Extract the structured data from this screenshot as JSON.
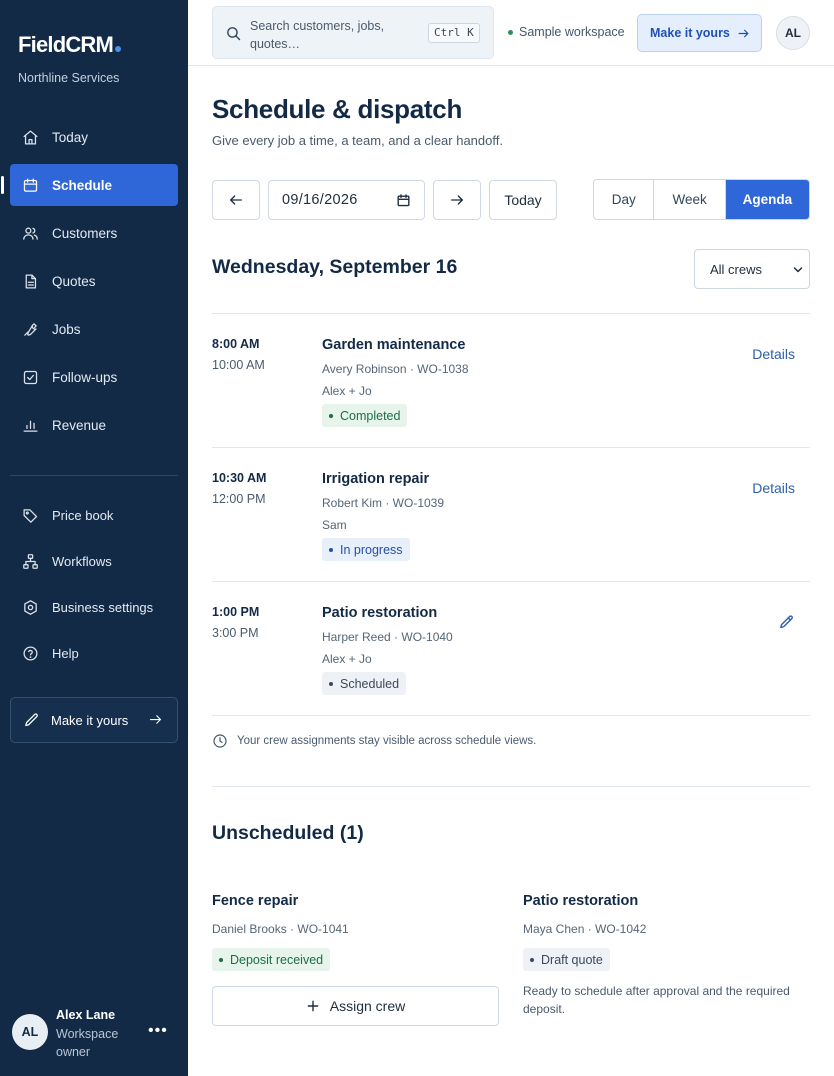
{
  "app": {
    "brand": "FieldCRM",
    "org": "Northline Services",
    "accent_color": "#2f66d8",
    "sidebar_color": "#132a46"
  },
  "sidebar": {
    "items": [
      {
        "label": "Today",
        "icon": "home-icon"
      },
      {
        "label": "Schedule",
        "icon": "calendar-icon",
        "active": true
      },
      {
        "label": "Customers",
        "icon": "users-icon"
      },
      {
        "label": "Quotes",
        "icon": "document-icon"
      },
      {
        "label": "Jobs",
        "icon": "wrench-icon"
      },
      {
        "label": "Follow-ups",
        "icon": "checkbox-icon"
      },
      {
        "label": "Revenue",
        "icon": "bar-chart-icon"
      }
    ],
    "secondary": [
      {
        "label": "Price book",
        "icon": "tag-icon"
      },
      {
        "label": "Workflows",
        "icon": "workflow-icon"
      },
      {
        "label": "Business settings",
        "icon": "settings-icon"
      },
      {
        "label": "Help",
        "icon": "help-icon"
      }
    ],
    "make_it_yours": "Make it yours",
    "user": {
      "initials": "AL",
      "name": "Alex Lane",
      "role": "Workspace owner"
    }
  },
  "topbar": {
    "search_placeholder": "Search customers, jobs, quotes…",
    "shortcut": "Ctrl K",
    "workspace": "Sample workspace",
    "make_it_yours": "Make it yours",
    "avatar": "AL"
  },
  "page": {
    "title": "Schedule & dispatch",
    "subtitle": "Give every job a time, a team, and a clear handoff.",
    "date_value": "09/16/2026",
    "today_label": "Today",
    "views": [
      "Day",
      "Week",
      "Agenda"
    ],
    "active_view": "Agenda",
    "date_heading": "Wednesday, September 16",
    "crew_filter": "All crews"
  },
  "jobs": [
    {
      "start": "8:00 AM",
      "end": "10:00 AM",
      "title": "Garden maintenance",
      "meta": "Avery Robinson · WO-1038",
      "crew": "Alex + Jo",
      "status": "Completed",
      "action": "Details"
    },
    {
      "start": "10:30 AM",
      "end": "12:00 PM",
      "title": "Irrigation repair",
      "meta": "Robert Kim · WO-1039",
      "crew": "Sam",
      "status": "In progress",
      "action": "Details"
    },
    {
      "start": "1:00 PM",
      "end": "3:00 PM",
      "title": "Patio restoration",
      "meta": "Harper Reed · WO-1040",
      "crew": "Alex + Jo",
      "status": "Scheduled",
      "action": "edit-icon"
    }
  ],
  "note": "Your crew assignments stay visible across schedule views.",
  "unscheduled": {
    "title": "Unscheduled (1)",
    "cards": [
      {
        "title": "Fence repair",
        "meta": "Daniel Brooks · WO-1041",
        "status": "Deposit received",
        "action": "Assign crew"
      },
      {
        "title": "Patio restoration",
        "meta": "Maya Chen · WO-1042",
        "status": "Draft quote",
        "note": "Ready to schedule after approval and the required deposit."
      }
    ]
  }
}
